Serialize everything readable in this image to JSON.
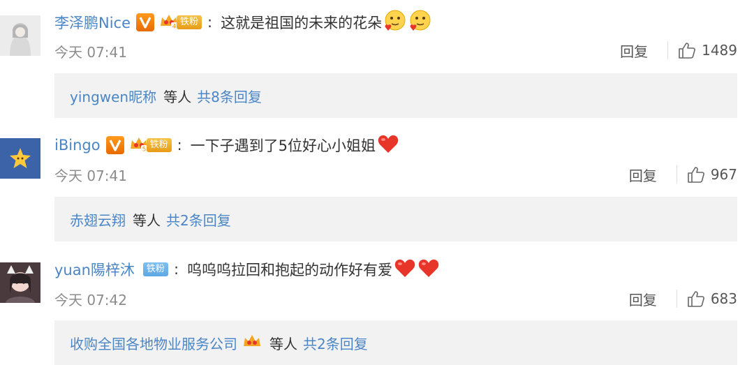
{
  "comments": [
    {
      "username": "李泽鹏Nice",
      "fan_label": "铁粉",
      "fan_level": "4",
      "text": "这就是祖国的未来的花朵",
      "emoji": [
        "face-hearts-emoji",
        "face-hearts-emoji"
      ],
      "time": "今天 07:41",
      "reply_label": "回复",
      "likes": "1489",
      "sub_reply": {
        "user": "yingwen昵称",
        "middle": "等人",
        "total": "共8条回复"
      }
    },
    {
      "username": "iBingo",
      "fan_label": "铁粉",
      "fan_level": "5",
      "text": "一下子遇到了5位好心小姐姐",
      "emoji": [
        "heart-emoji"
      ],
      "time": "今天 07:41",
      "reply_label": "回复",
      "likes": "967",
      "sub_reply": {
        "user": "赤翅云翔",
        "middle": "等人",
        "total": "共2条回复"
      }
    },
    {
      "username": "yuan陽梓沐",
      "fan_label": "铁粉",
      "text": "呜呜呜拉回和抱起的动作好有爱",
      "emoji": [
        "heart-emoji",
        "heart-emoji"
      ],
      "time": "今天 07:42",
      "reply_label": "回复",
      "likes": "683",
      "sub_reply": {
        "user": "收购全国各地物业服务公司",
        "middle": "等人",
        "total": "共2条回复"
      }
    }
  ],
  "colors": {
    "link": "#4a86c6",
    "meta": "#8c8c8c",
    "sub_bg": "#f2f2f2",
    "verified": "#f08a12",
    "fan_gold": "#f0ad2e",
    "fan_blue": "#6cb2ea",
    "heart": "#e8352a"
  }
}
